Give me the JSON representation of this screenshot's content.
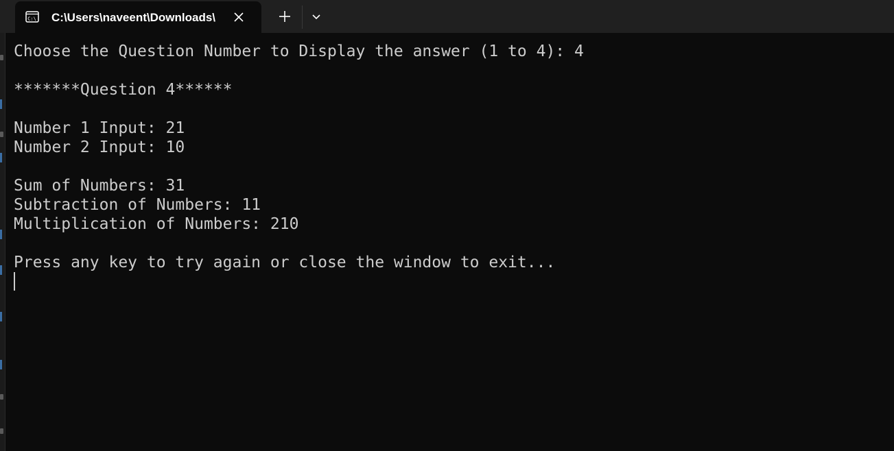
{
  "tab": {
    "title": "C:\\Users\\naveent\\Downloads\\",
    "icon": "terminal-icon"
  },
  "titlebar": {
    "new_tab_icon": "plus-icon",
    "dropdown_icon": "chevron-down-icon",
    "close_icon": "close-icon"
  },
  "console": {
    "prompt": "Choose the Question Number to Display the answer (1 to 4): 4",
    "question_header": "*******Question 4******",
    "number1": "Number 1 Input: 21",
    "number2": "Number 2 Input: 10",
    "sum": "Sum of Numbers: 31",
    "subtraction": "Subtraction of Numbers: 11",
    "multiplication": "Multiplication of Numbers: 210",
    "press_key": "Press any key to try again or close the window to exit..."
  },
  "colors": {
    "console_bg": "#0c0c0c",
    "titlebar_bg": "#202020",
    "text": "#cccccc"
  }
}
